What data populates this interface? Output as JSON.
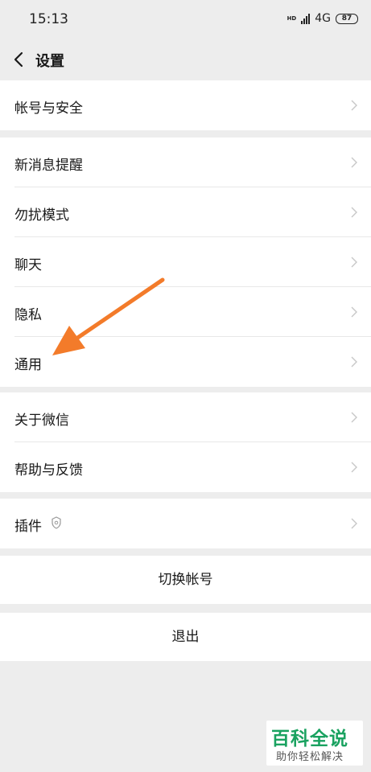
{
  "status_bar": {
    "time": "15:13",
    "hd": "HD",
    "network": "4G",
    "battery": "87"
  },
  "nav": {
    "title": "设置"
  },
  "groups": [
    {
      "items": [
        {
          "label": "帐号与安全"
        }
      ]
    },
    {
      "items": [
        {
          "label": "新消息提醒"
        },
        {
          "label": "勿扰模式"
        },
        {
          "label": "聊天"
        },
        {
          "label": "隐私"
        },
        {
          "label": "通用"
        }
      ]
    },
    {
      "items": [
        {
          "label": "关于微信"
        },
        {
          "label": "帮助与反馈"
        }
      ]
    },
    {
      "items": [
        {
          "label": "插件"
        }
      ]
    }
  ],
  "buttons": {
    "switch_account": "切换帐号",
    "logout": "退出"
  },
  "watermark": {
    "title": "百科全说",
    "subtitle": "助你轻松解决"
  },
  "colors": {
    "background": "#ededed",
    "row": "#ffffff",
    "annotation_arrow": "#f37b2a",
    "watermark_green": "#1aa260"
  }
}
